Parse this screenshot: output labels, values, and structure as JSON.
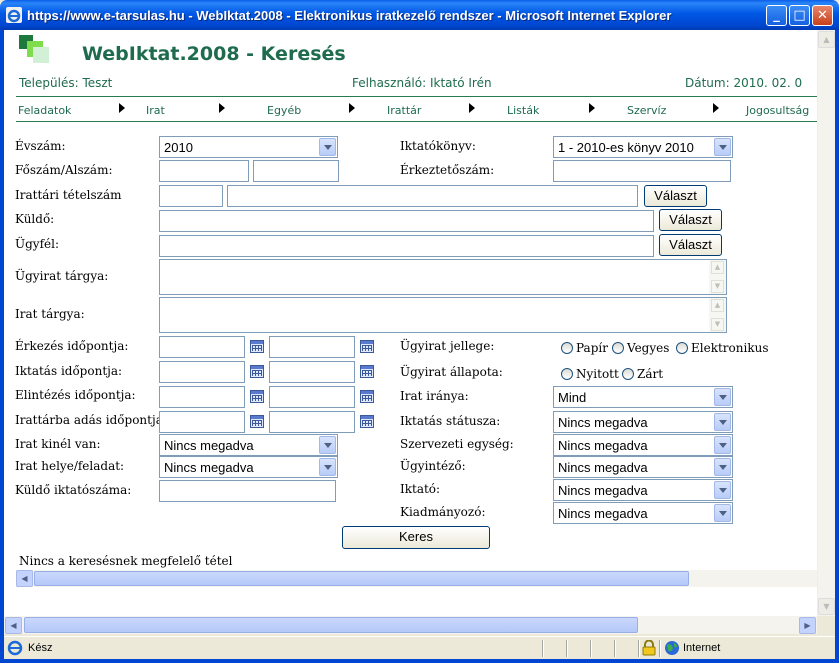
{
  "window": {
    "title": "https://www.e-tarsulas.hu - WebIktat.2008 - Elektronikus iratkezelő rendszer - Microsoft Internet Explorer",
    "minimize": "_",
    "maximize": "□",
    "close": "✕"
  },
  "header": {
    "app_title": "WebIktat.2008 - Keresés",
    "telepules": "Település: Teszt",
    "felhasznalo": "Felhasználó: Iktató Irén",
    "datum": "Dátum: 2010. 02. 0"
  },
  "menu": [
    "Feladatok",
    "Irat",
    "Egyéb",
    "Irattár",
    "Listák",
    "Szervíz",
    "Jogosultság"
  ],
  "form": {
    "evszam_label": "Évszám:",
    "evszam_value": "2010",
    "iktatokonyv_label": "Iktatókönyv:",
    "iktatokonyv_value": "1 - 2010-es könyv 2010",
    "foszam_label": "Főszám/Alszám:",
    "erkezteto_label": "Érkeztetőszám:",
    "tetelszam_label": "Irattári tételszám",
    "kuldo_label": "Küldő:",
    "ugyfel_label": "Ügyfél:",
    "valaszt": "Választ",
    "ugyirat_targya_label": "Ügyirat tárgya:",
    "irat_targya_label": "Irat tárgya:",
    "erkezes_label": "Érkezés időpontja:",
    "iktatas_label": "Iktatás időpontja:",
    "elintezes_label": "Elintézés időpontja:",
    "irattarba_label": "Irattárba adás időpontja:",
    "irat_kinel_label": "Irat kinél van:",
    "irat_helye_label": "Irat helye/feladat:",
    "kuldo_iktato_label": "Küldő iktatószáma:",
    "ugyirat_jellege_label": "Ügyirat jellege:",
    "jellege_options": [
      "Papír",
      "Vegyes",
      "Elektronikus"
    ],
    "ugyirat_allapota_label": "Ügyirat állapota:",
    "allapota_options": [
      "Nyitott",
      "Zárt"
    ],
    "irat_iranya_label": "Irat iránya:",
    "irat_iranya_value": "Mind",
    "iktatas_statusza_label": "Iktatás státusza:",
    "szervezeti_label": "Szervezeti egység:",
    "ugyintezo_label": "Ügyintéző:",
    "iktato_label": "Iktató:",
    "kiadmanyozo_label": "Kiadmányozó:",
    "nincs": "Nincs megadva",
    "search_button": "Keres",
    "result_text": "Nincs a keresésnek megfelelő tétel"
  },
  "statusbar": {
    "status": "Kész",
    "zone": "Internet"
  },
  "colors": {
    "titlebar": "#0058e6",
    "brand_green": "#1e6b4e",
    "field_border": "#7f9db9"
  }
}
